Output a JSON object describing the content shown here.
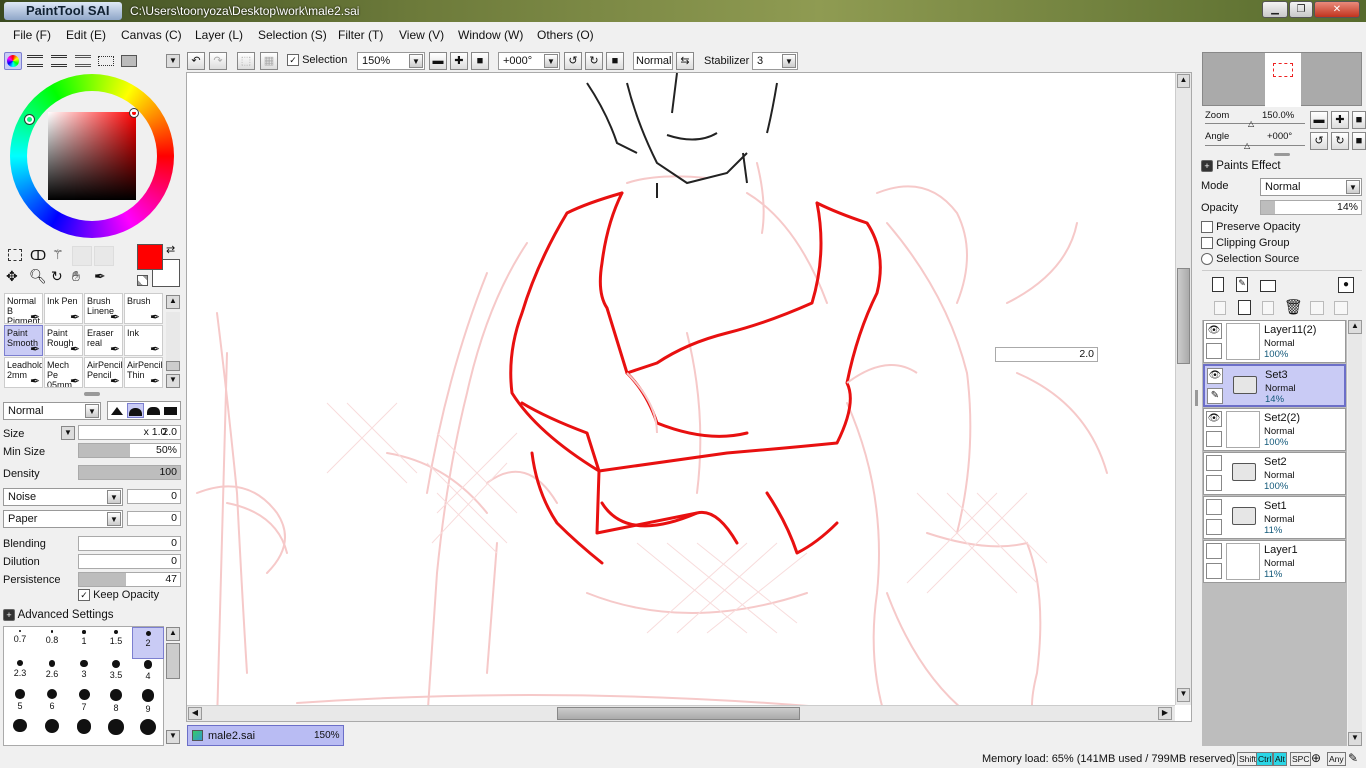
{
  "app": {
    "logo": "PaintTool SAI",
    "path": "C:\\Users\\toonyoza\\Desktop\\work\\male2.sai"
  },
  "window_controls": {
    "minimize": "▁",
    "restore": "❐",
    "close": "✕"
  },
  "menu": [
    "File (F)",
    "Edit (E)",
    "Canvas (C)",
    "Layer (L)",
    "Selection (S)",
    "Filter (T)",
    "View (V)",
    "Window (W)",
    "Others (O)"
  ],
  "toolbar": {
    "selection_label": "Selection",
    "zoom": "150%",
    "angle": "+000°",
    "blend_mode": "Normal",
    "stabilizer_label": "Stabilizer",
    "stabilizer_value": "3"
  },
  "color": {
    "primary": "#ff0000",
    "secondary": "#ffffff",
    "accent": "#c9cbf5"
  },
  "tools": [
    {
      "l1": "Normal B",
      "l2": "Pigment"
    },
    {
      "l1": "Ink Pen",
      "l2": ""
    },
    {
      "l1": "Brush",
      "l2": "Linene"
    },
    {
      "l1": "Brush",
      "l2": ""
    },
    {
      "l1": "Paint",
      "l2": "Smooth"
    },
    {
      "l1": "Paint",
      "l2": "Rough"
    },
    {
      "l1": "Eraser",
      "l2": "real"
    },
    {
      "l1": "Ink",
      "l2": ""
    },
    {
      "l1": "Leadhold",
      "l2": "2mm"
    },
    {
      "l1": "Mech Pe",
      "l2": "05mm"
    },
    {
      "l1": "AirPencil",
      "l2": "Pencil"
    },
    {
      "l1": "AirPencil",
      "l2": "Thin"
    }
  ],
  "brush": {
    "mode": "Normal",
    "size_label": "Size",
    "size_mult": "x 1.0",
    "size_value": "2.0",
    "min_size_label": "Min Size",
    "min_size_value": "50%",
    "min_size_frac": 0.5,
    "density_label": "Density",
    "density_value": "100",
    "noise": "Noise",
    "noise_value": "0",
    "paper": "Paper",
    "paper_value": "0",
    "blending_label": "Blending",
    "blending_value": "0",
    "dilution_label": "Dilution",
    "dilution_value": "0",
    "persistence_label": "Persistence",
    "persistence_value": "47",
    "persistence_frac": 0.47,
    "keep_opacity": "Keep Opacity",
    "advanced": "Advanced Settings"
  },
  "brush_sizes": [
    "0.7",
    "0.8",
    "1",
    "1.5",
    "2",
    "2.3",
    "2.6",
    "3",
    "3.5",
    "4",
    "5",
    "6",
    "7",
    "8",
    "9",
    "",
    "",
    "",
    "",
    ""
  ],
  "canvas": {
    "tooltip_value": "2.0"
  },
  "tab": {
    "name": "male2.sai",
    "zoom": "150%"
  },
  "navigator": {
    "zoom_label": "Zoom",
    "zoom_value": "150.0%",
    "angle_label": "Angle",
    "angle_value": "+000°"
  },
  "layer_panel": {
    "paints_effect": "Paints Effect",
    "mode_label": "Mode",
    "mode_value": "Normal",
    "opacity_label": "Opacity",
    "opacity_value": "14%",
    "opacity_frac": 0.14,
    "preserve_opacity": "Preserve Opacity",
    "clipping_group": "Clipping Group",
    "selection_source": "Selection Source"
  },
  "layers": [
    {
      "name": "Layer11(2)",
      "mode": "Normal",
      "opacity": "100%",
      "type": "layer",
      "visible": true,
      "selected": false
    },
    {
      "name": "Set3",
      "mode": "Normal",
      "opacity": "14%",
      "type": "folder",
      "visible": true,
      "selected": true
    },
    {
      "name": "Set2(2)",
      "mode": "Normal",
      "opacity": "100%",
      "type": "layer",
      "visible": true,
      "selected": false
    },
    {
      "name": "Set2",
      "mode": "Normal",
      "opacity": "100%",
      "type": "folder",
      "visible": false,
      "selected": false
    },
    {
      "name": "Set1",
      "mode": "Normal",
      "opacity": "11%",
      "type": "folder",
      "visible": false,
      "selected": false
    },
    {
      "name": "Layer1",
      "mode": "Normal",
      "opacity": "11%",
      "type": "layer",
      "visible": false,
      "selected": false
    }
  ],
  "status": {
    "memory": "Memory load: 65% (141MB used / 799MB reserved)",
    "keys": [
      "Shift",
      "Ctrl",
      "Alt",
      "SPC",
      "Any"
    ]
  }
}
